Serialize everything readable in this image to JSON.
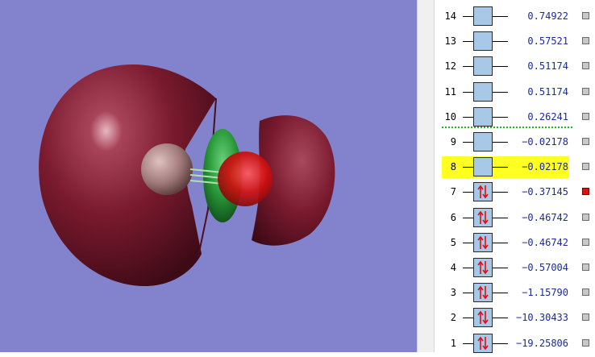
{
  "viewer": {
    "background": "#8383cd",
    "lobe_color": "#7a1a2e",
    "negative_lobe_color": "#2a9a3a",
    "atom_carbon_color": "#b08888",
    "atom_oxygen_color": "#d01010"
  },
  "orbital_panel": {
    "highlight_color": "#ffff22",
    "homo_lumo_divider_color": "#20b020",
    "orbitals": [
      {
        "index": "14",
        "energy": "0.74922",
        "occupied": false,
        "checked": false,
        "selected": false
      },
      {
        "index": "13",
        "energy": "0.57521",
        "occupied": false,
        "checked": false,
        "selected": false
      },
      {
        "index": "12",
        "energy": "0.51174",
        "occupied": false,
        "checked": false,
        "selected": false
      },
      {
        "index": "11",
        "energy": "0.51174",
        "occupied": false,
        "checked": false,
        "selected": false
      },
      {
        "index": "10",
        "energy": "0.26241",
        "occupied": false,
        "checked": false,
        "selected": false
      },
      {
        "index": "9",
        "energy": "−0.02178",
        "occupied": false,
        "checked": false,
        "selected": false
      },
      {
        "index": "8",
        "energy": "−0.02178",
        "occupied": false,
        "checked": false,
        "selected": true
      },
      {
        "index": "7",
        "energy": "−0.37145",
        "occupied": true,
        "checked": true,
        "selected": false
      },
      {
        "index": "6",
        "energy": "−0.46742",
        "occupied": true,
        "checked": false,
        "selected": false
      },
      {
        "index": "5",
        "energy": "−0.46742",
        "occupied": true,
        "checked": false,
        "selected": false
      },
      {
        "index": "4",
        "energy": "−0.57004",
        "occupied": true,
        "checked": false,
        "selected": false
      },
      {
        "index": "3",
        "energy": "−1.15790",
        "occupied": true,
        "checked": false,
        "selected": false
      },
      {
        "index": "2",
        "energy": "−10.30433",
        "occupied": true,
        "checked": false,
        "selected": false
      },
      {
        "index": "1",
        "energy": "−19.25806",
        "occupied": true,
        "checked": false,
        "selected": false
      }
    ]
  }
}
